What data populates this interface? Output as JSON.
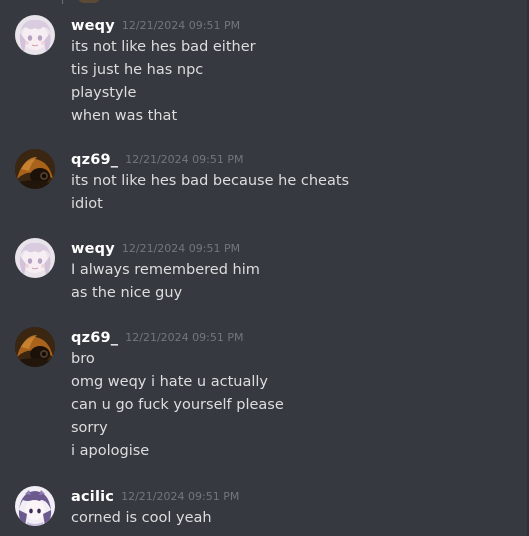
{
  "messages": [
    {
      "username": "weqy",
      "timestamp": "12/21/2024 09:51 PM",
      "avatar_icon": "anime-girl-avatar",
      "lines": [
        "its not like hes bad either",
        "tis just he has npc",
        "playstyle",
        "when was that"
      ]
    },
    {
      "username": "qz69_",
      "timestamp": "12/21/2024 09:51 PM",
      "avatar_icon": "dark-creature-avatar",
      "lines": [
        "its not like hes bad because he cheats",
        "idiot"
      ]
    },
    {
      "username": "weqy",
      "timestamp": "12/21/2024 09:51 PM",
      "avatar_icon": "anime-girl-avatar",
      "lines": [
        "I always remembered him",
        "as the nice guy"
      ]
    },
    {
      "username": "qz69_",
      "timestamp": "12/21/2024 09:51 PM",
      "avatar_icon": "dark-creature-avatar",
      "lines": [
        "bro",
        "omg weqy i hate u actually",
        "can u go fuck yourself please",
        "sorry",
        "i apologise"
      ]
    },
    {
      "username": "acilic",
      "timestamp": "12/21/2024 09:51 PM",
      "avatar_icon": "purple-anime-avatar",
      "lines": [
        "corned is cool yeah"
      ]
    }
  ],
  "colors": {
    "background": "#36393f",
    "username": "#ffffff",
    "timestamp": "#72767d",
    "message_text": "#dcddde"
  }
}
